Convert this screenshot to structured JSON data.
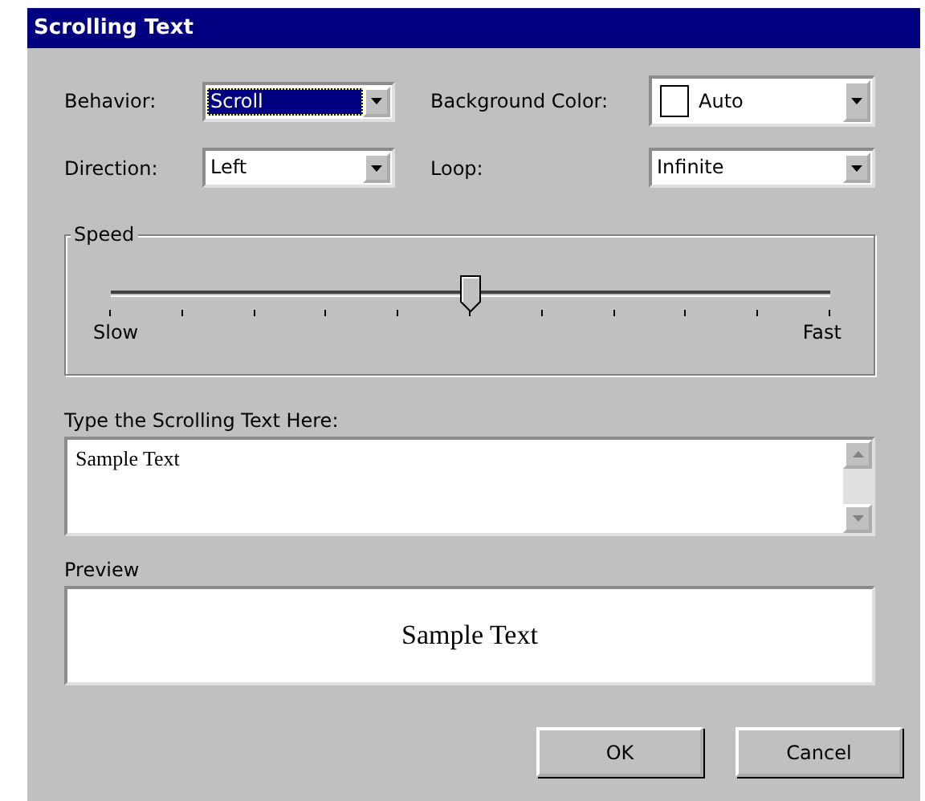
{
  "window": {
    "title": "Scrolling Text"
  },
  "fields": [
    {
      "label": "Behavior:",
      "value": "Scroll",
      "kind": "combo",
      "focused": true
    },
    {
      "label": "Background Color:",
      "value": "Auto",
      "kind": "color-combo",
      "focused": false
    },
    {
      "label": "Direction:",
      "value": "Left",
      "kind": "combo",
      "focused": false
    },
    {
      "label": "Loop:",
      "value": "Infinite",
      "kind": "combo",
      "focused": false
    }
  ],
  "speed": {
    "title": "Speed",
    "level": 0.5,
    "min_label": "Slow",
    "max_label": "Fast"
  },
  "text_entry": {
    "label": "Type the Scrolling Text Here:",
    "value": "Sample Text"
  },
  "preview": {
    "label": "Preview",
    "text": "Sample Text"
  },
  "buttons": [
    "OK",
    "Cancel"
  ]
}
